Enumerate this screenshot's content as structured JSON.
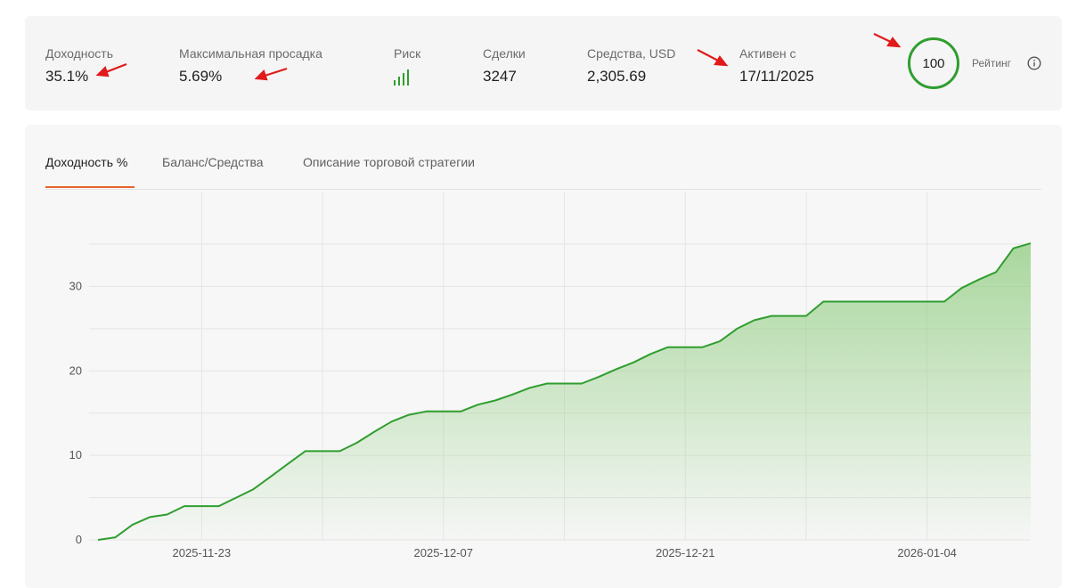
{
  "stats": {
    "yield_label": "Доходность",
    "yield_value": "35.1%",
    "drawdown_label": "Максимальная просадка",
    "drawdown_value": "5.69%",
    "risk_label": "Риск",
    "risk_level": 4,
    "deals_label": "Сделки",
    "deals_value": "3247",
    "equity_label": "Средства, USD",
    "equity_value": "2,305.69",
    "active_label": "Активен с",
    "active_value": "17/11/2025",
    "rating_value": "100",
    "rating_label": "Рейтинг"
  },
  "tabs": [
    {
      "label": "Доходность %",
      "active": true
    },
    {
      "label": "Баланс/Средства",
      "active": false
    },
    {
      "label": "Описание торговой стратегии",
      "active": false
    }
  ],
  "colors": {
    "accent": "#e8622c",
    "line": "#2f9e2f",
    "annotation": "#e11b1b"
  },
  "chart_data": {
    "type": "area",
    "x_ticks": [
      "2025-11-23",
      "2025-12-07",
      "2025-12-21",
      "2026-01-04"
    ],
    "y_ticks": [
      0,
      10,
      20,
      30
    ],
    "ylim": [
      0,
      35
    ],
    "grid": true,
    "series": [
      {
        "values": [
          [
            "2025-11-17",
            0
          ],
          [
            "2025-11-18",
            0.3
          ],
          [
            "2025-11-19",
            1.8
          ],
          [
            "2025-11-20",
            2.7
          ],
          [
            "2025-11-21",
            3
          ],
          [
            "2025-11-22",
            4
          ],
          [
            "2025-11-24",
            4
          ],
          [
            "2025-11-25",
            5
          ],
          [
            "2025-11-26",
            6
          ],
          [
            "2025-11-27",
            7.5
          ],
          [
            "2025-11-28",
            9
          ],
          [
            "2025-11-29",
            10.5
          ],
          [
            "2025-12-01",
            10.5
          ],
          [
            "2025-12-02",
            11.5
          ],
          [
            "2025-12-03",
            12.8
          ],
          [
            "2025-12-04",
            14
          ],
          [
            "2025-12-05",
            14.8
          ],
          [
            "2025-12-06",
            15.2
          ],
          [
            "2025-12-08",
            15.2
          ],
          [
            "2025-12-09",
            16
          ],
          [
            "2025-12-10",
            16.5
          ],
          [
            "2025-12-11",
            17.2
          ],
          [
            "2025-12-12",
            18
          ],
          [
            "2025-12-13",
            18.5
          ],
          [
            "2025-12-15",
            18.5
          ],
          [
            "2025-12-16",
            19.3
          ],
          [
            "2025-12-17",
            20.2
          ],
          [
            "2025-12-18",
            21
          ],
          [
            "2025-12-19",
            22
          ],
          [
            "2025-12-20",
            22.8
          ],
          [
            "2025-12-22",
            22.8
          ],
          [
            "2025-12-23",
            23.5
          ],
          [
            "2025-12-24",
            25
          ],
          [
            "2025-12-25",
            26
          ],
          [
            "2025-12-26",
            26.5
          ],
          [
            "2025-12-28",
            26.5
          ],
          [
            "2025-12-29",
            28.2
          ],
          [
            "2026-01-05",
            28.2
          ],
          [
            "2026-01-06",
            29.8
          ],
          [
            "2026-01-07",
            30.8
          ],
          [
            "2026-01-08",
            31.7
          ],
          [
            "2026-01-09",
            34.5
          ],
          [
            "2026-01-10",
            35.1
          ]
        ]
      }
    ]
  }
}
